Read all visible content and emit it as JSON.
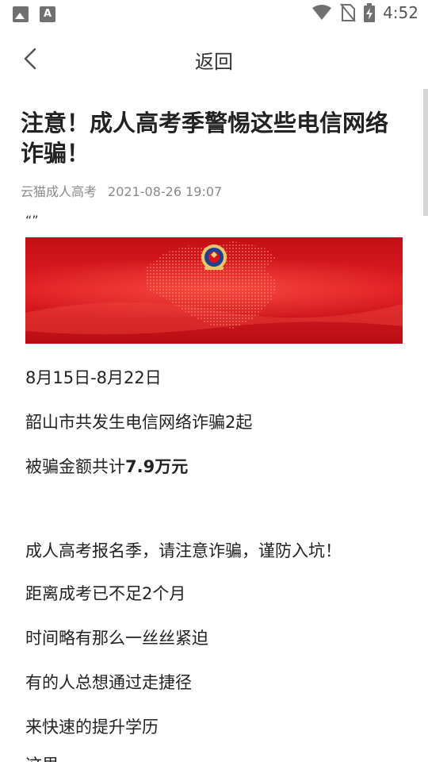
{
  "status_bar": {
    "time": "4:52",
    "left_icons": [
      "gallery-icon",
      "font-a-icon"
    ],
    "right_icons": [
      "wifi-icon",
      "no-sim-icon",
      "battery-charging-icon"
    ]
  },
  "nav": {
    "back_icon": "chevron-left-icon",
    "title": "返回"
  },
  "article": {
    "title": "注意！成人高考季警惕这些电信网络诈骗！",
    "title_line1": "注意！成人高考季警惕这些电信网络",
    "title_line2": "诈骗！",
    "source": "云猫成人高考",
    "datetime": "2021-08-26 19:07",
    "quote": "“”",
    "banner_image": "police-emblem-over-china-map-banner",
    "paragraphs": [
      {
        "text": "8月15日-8月22日"
      },
      {
        "text": "韶山市共发生电信网络诈骗2起"
      },
      {
        "text": "被骗金额共计",
        "bold": "7.9万元"
      },
      {
        "text": "成人高考报名季，请注意诈骗，谨防入坑！"
      },
      {
        "text": "距离成考已不足2个月"
      },
      {
        "text": "时间略有那么一丝丝紧迫"
      },
      {
        "text": "有的人总想通过走捷径"
      },
      {
        "text": "来快速的提升学历"
      },
      {
        "text": "这里"
      }
    ]
  },
  "colors": {
    "banner_red": "#d8141d",
    "meta_gray": "#8a8a8a",
    "text": "#222222"
  }
}
